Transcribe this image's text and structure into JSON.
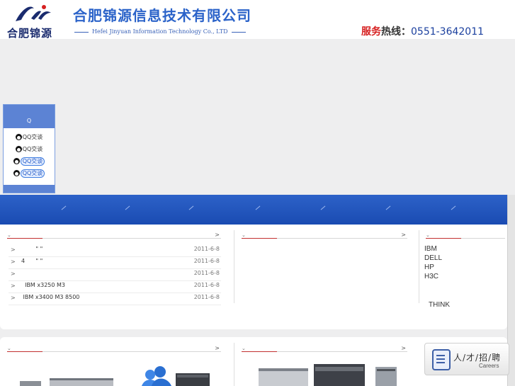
{
  "header": {
    "logo_text": "合肥锦源",
    "company_cn": "合肥锦源信息技术有限公司",
    "company_en": "Hefei Jinyuan Information Technology Co., LTD",
    "hotline": {
      "label_red": "服务",
      "label_dark": "热线：",
      "number": "0551-3642011"
    }
  },
  "qq_panel": {
    "title": "Q",
    "items": [
      {
        "label": "QQ交谈",
        "style": "plain"
      },
      {
        "label": "QQ交谈",
        "style": "plain"
      },
      {
        "label": "QQ交谈",
        "style": "pill"
      },
      {
        "label": "QQ交谈",
        "style": "pill"
      }
    ]
  },
  "nav": {
    "separator": "/"
  },
  "news": {
    "more": ">",
    "rows": [
      {
        "bullet": ">",
        "title": "        \" \"",
        "date": "2011-6-8"
      },
      {
        "bullet": ">",
        "title": "4      \" \"",
        "date": "2011-6-8"
      },
      {
        "bullet": ">",
        "title": "",
        "date": "2011-6-8"
      },
      {
        "bullet": ">",
        "title": "  IBM x3250 M3",
        "date": "2011-6-8"
      },
      {
        "bullet": ">",
        "title": " IBM x3400 M3  8500",
        "date": "2011-6-8"
      }
    ]
  },
  "middle_box": {
    "more": ">"
  },
  "brands": {
    "list": [
      "IBM",
      "DELL",
      "HP",
      "H3C"
    ],
    "extra": "THINK"
  },
  "lower": {
    "left_more": ">",
    "mid_more": ">"
  },
  "careers": {
    "label_cn": "人/才/招/聘",
    "label_en": "Careers"
  }
}
